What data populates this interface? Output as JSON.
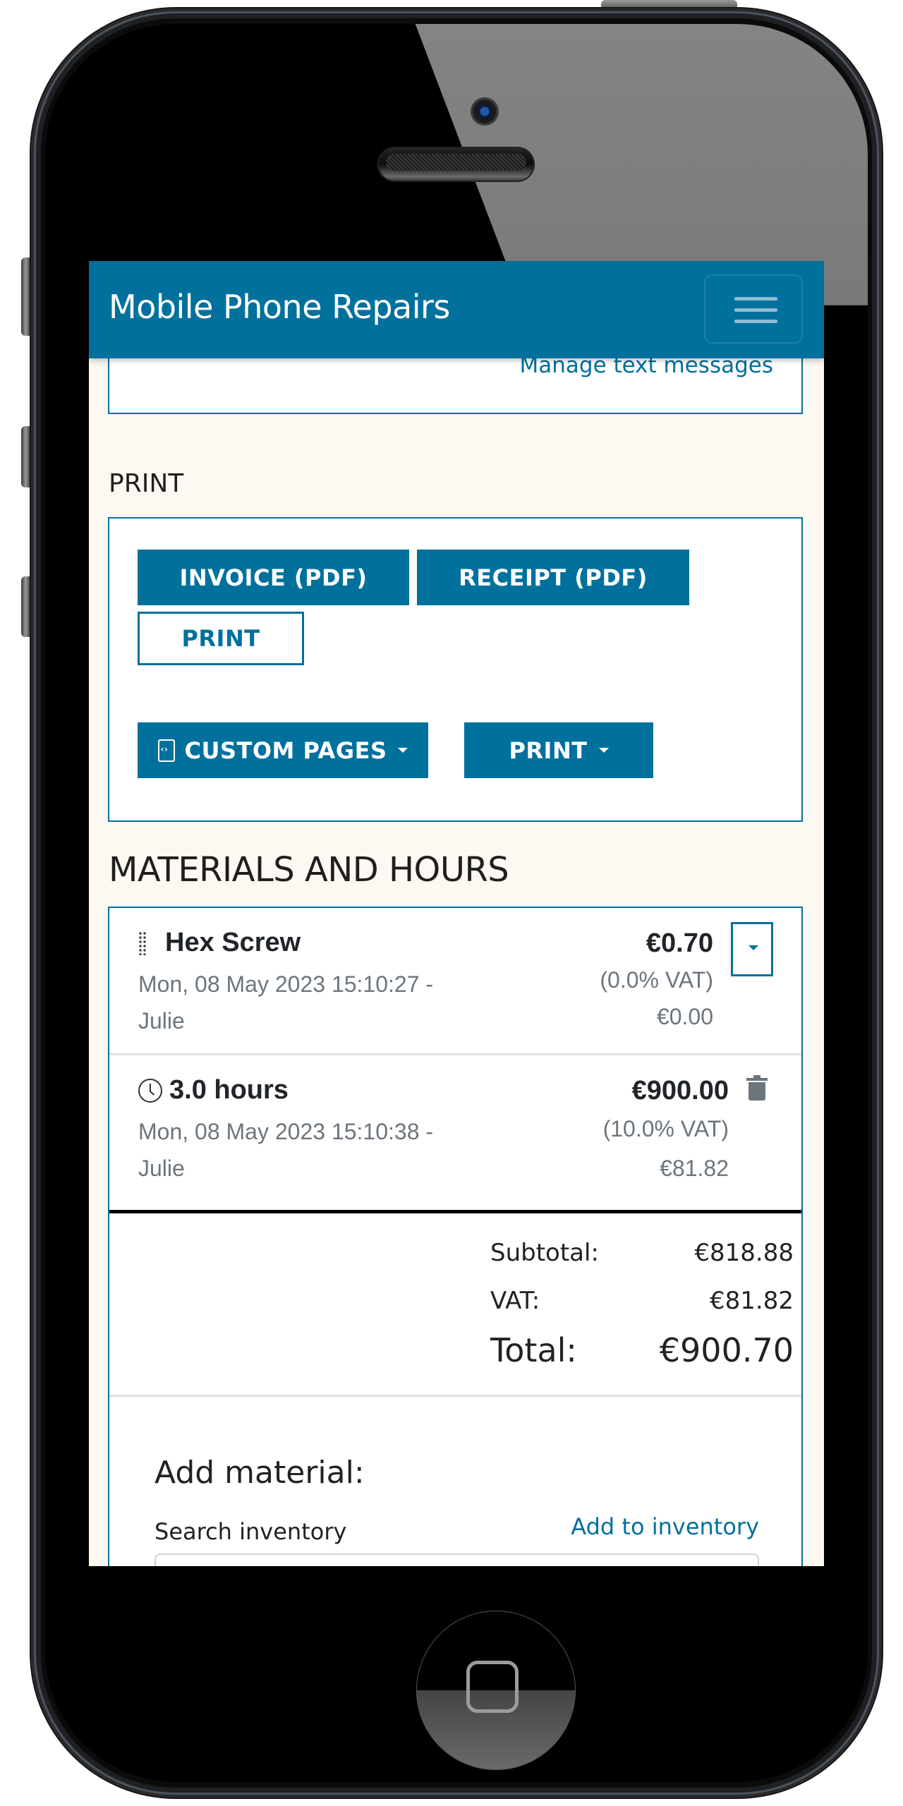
{
  "app": {
    "title": "Mobile Phone Repairs",
    "menu_icon": "hamburger-menu-icon"
  },
  "messages": {
    "manage_link": "Manage text messages"
  },
  "print_section": {
    "title": "PRINT",
    "buttons": {
      "invoice_pdf": "INVOICE (PDF)",
      "receipt_pdf": "RECEIPT (PDF)",
      "print": "PRINT",
      "custom_pages": "CUSTOM PAGES",
      "print_dropdown": "PRINT"
    }
  },
  "materials": {
    "title": "MATERIALS AND HOURS",
    "items": [
      {
        "type": "material",
        "icon": "drag-handle-icon",
        "name": "Hex Screw",
        "timestamp": "Mon, 08 May 2023 15:10:27 -",
        "user": "Julie",
        "price": "€0.70",
        "vat_rate": "(0.0% VAT)",
        "vat_amount": "€0.00",
        "action_icon": "dropdown-caret-icon"
      },
      {
        "type": "hours",
        "icon": "clock-icon",
        "name": "3.0 hours",
        "timestamp": "Mon, 08 May 2023 15:10:38 -",
        "user": "Julie",
        "price": "€900.00",
        "vat_rate": "(10.0% VAT)",
        "vat_amount": "€81.82",
        "action_icon": "trash-icon"
      }
    ],
    "totals": {
      "subtotal_label": "Subtotal:",
      "subtotal_value": "€818.88",
      "vat_label": "VAT:",
      "vat_value": "€81.82",
      "total_label": "Total:",
      "total_value": "€900.70"
    },
    "add_material": {
      "title": "Add material:",
      "search_label": "Search inventory",
      "add_to_inventory_link": "Add to inventory",
      "search_value": "",
      "search_placeholder": ""
    }
  },
  "colors": {
    "brand": "#00709c",
    "page_background": "#fdf8f1"
  }
}
